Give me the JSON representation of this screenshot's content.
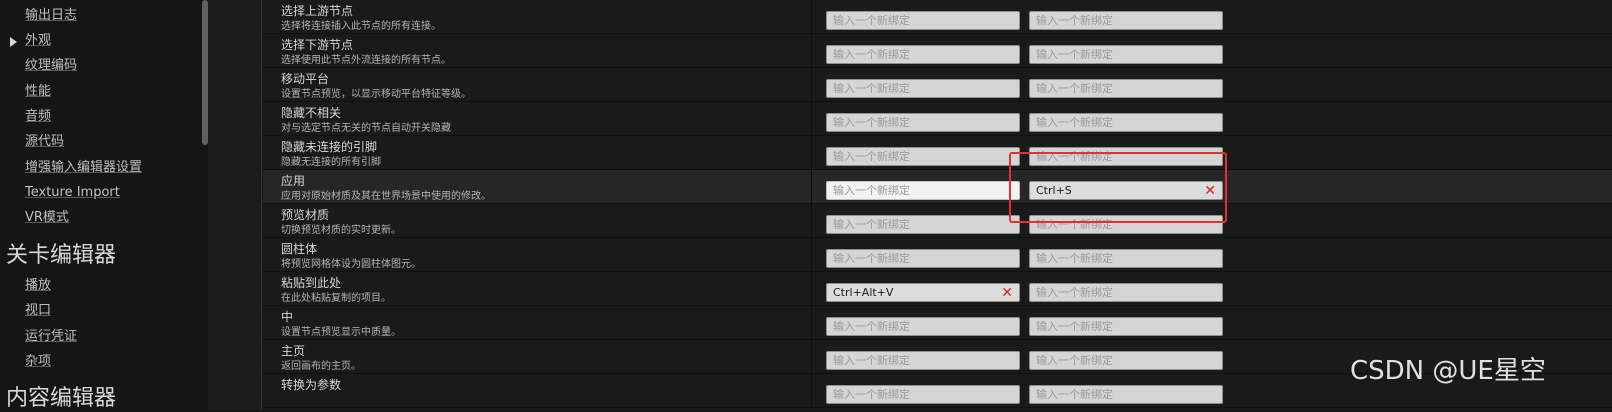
{
  "sidebar": {
    "items_top": [
      "输出日志",
      "外观",
      "纹理编码",
      "性能",
      "音频",
      "源代码",
      "增强输入编辑器设置",
      "Texture Import",
      "VR模式"
    ],
    "heading1": "关卡编辑器",
    "items_mid": [
      "播放",
      "视口",
      "运行凭证",
      "杂项"
    ],
    "heading2": "内容编辑器"
  },
  "placeholder": "输入一个新绑定",
  "commands": [
    {
      "name": "选择上游节点",
      "desc": "选择将连接插入此节点的所有连接。",
      "binding1": "",
      "binding2": ""
    },
    {
      "name": "选择下游节点",
      "desc": "选择使用此节点外流连接的所有节点。",
      "binding1": "",
      "binding2": ""
    },
    {
      "name": "移动平台",
      "desc": "设置节点预览，以显示移动平台特征等级。",
      "binding1": "",
      "binding2": ""
    },
    {
      "name": "隐藏不相关",
      "desc": "对与选定节点无关的节点自动开关隐藏",
      "binding1": "",
      "binding2": ""
    },
    {
      "name": "隐藏未连接的引脚",
      "desc": "隐藏无连接的所有引脚",
      "binding1": "",
      "binding2": ""
    },
    {
      "name": "应用",
      "desc": "应用对原始材质及其在世界场景中使用的修改。",
      "binding1": "",
      "binding2": "Ctrl+S"
    },
    {
      "name": "预览材质",
      "desc": "切换预览材质的实时更新。",
      "binding1": "",
      "binding2": ""
    },
    {
      "name": "圆柱体",
      "desc": "将预览网格体设为圆柱体图元。",
      "binding1": "",
      "binding2": ""
    },
    {
      "name": "粘贴到此处",
      "desc": "在此处粘贴复制的项目。",
      "binding1": "Ctrl+Alt+V",
      "binding2": ""
    },
    {
      "name": "中",
      "desc": "设置节点预览显示中质量。",
      "binding1": "",
      "binding2": ""
    },
    {
      "name": "主页",
      "desc": "返回画布的主页。",
      "binding1": "",
      "binding2": ""
    },
    {
      "name": "转换为参数",
      "desc": "",
      "binding1": "",
      "binding2": ""
    }
  ],
  "clear_glyph": "✕",
  "watermark": "CSDN @UE星空",
  "colors": {
    "highlight": "#e53030",
    "clear_icon": "#d32222"
  }
}
